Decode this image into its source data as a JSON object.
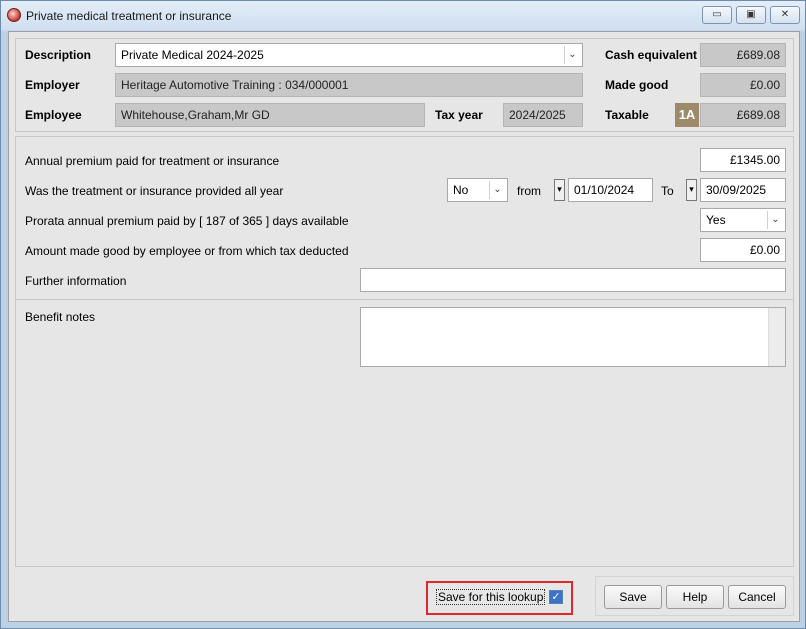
{
  "window": {
    "title": "Private medical treatment or insurance",
    "controls": {
      "minimize": "▭",
      "maximize": "▣",
      "close": "✕"
    }
  },
  "header": {
    "description_label": "Description",
    "description_value": "Private Medical 2024-2025",
    "employer_label": "Employer",
    "employer_value": "Heritage Automotive Training : 034/000001",
    "employee_label": "Employee",
    "employee_value": "Whitehouse,Graham,Mr GD",
    "tax_year_label": "Tax year",
    "tax_year_value": "2024/2025",
    "cash_equivalent_label": "Cash equivalent",
    "cash_equivalent_value": "£689.08",
    "made_good_label": "Made good",
    "made_good_value": "£0.00",
    "taxable_label": "Taxable",
    "taxable_badge": "1A",
    "taxable_value": "£689.08"
  },
  "details": {
    "annual_premium_label": "Annual premium paid for treatment or insurance",
    "annual_premium_value": "£1345.00",
    "all_year_label": "Was the treatment or insurance provided all year",
    "all_year_value": "No",
    "from_label": "from",
    "from_date": "01/10/2024",
    "to_label": "To",
    "to_date": "30/09/2025",
    "prorata_label": "Prorata annual premium paid by [ 187 of 365 ] days available",
    "prorata_value": "Yes",
    "made_good_label": "Amount made good by employee or from which tax deducted",
    "made_good_value": "£0.00",
    "further_info_label": "Further information",
    "further_info_value": ""
  },
  "notes": {
    "label": "Benefit notes",
    "value": ""
  },
  "footer": {
    "save_lookup_label": "Save for this lookup",
    "save_lookup_checked": true,
    "save_label": "Save",
    "help_label": "Help",
    "cancel_label": "Cancel"
  },
  "colors": {
    "highlight": "#e0262e",
    "badge": "#9c8a6b",
    "readonly_field": "#c8c8c8"
  }
}
